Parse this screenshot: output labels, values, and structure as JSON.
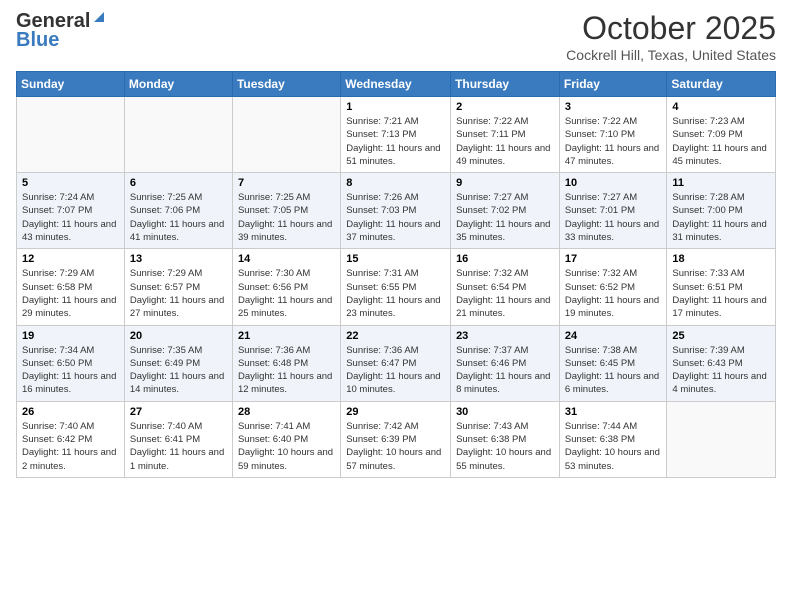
{
  "header": {
    "logo_general": "General",
    "logo_blue": "Blue",
    "month_title": "October 2025",
    "subtitle": "Cockrell Hill, Texas, United States"
  },
  "days_of_week": [
    "Sunday",
    "Monday",
    "Tuesday",
    "Wednesday",
    "Thursday",
    "Friday",
    "Saturday"
  ],
  "weeks": [
    [
      {
        "day": "",
        "info": ""
      },
      {
        "day": "",
        "info": ""
      },
      {
        "day": "",
        "info": ""
      },
      {
        "day": "1",
        "info": "Sunrise: 7:21 AM\nSunset: 7:13 PM\nDaylight: 11 hours and 51 minutes."
      },
      {
        "day": "2",
        "info": "Sunrise: 7:22 AM\nSunset: 7:11 PM\nDaylight: 11 hours and 49 minutes."
      },
      {
        "day": "3",
        "info": "Sunrise: 7:22 AM\nSunset: 7:10 PM\nDaylight: 11 hours and 47 minutes."
      },
      {
        "day": "4",
        "info": "Sunrise: 7:23 AM\nSunset: 7:09 PM\nDaylight: 11 hours and 45 minutes."
      }
    ],
    [
      {
        "day": "5",
        "info": "Sunrise: 7:24 AM\nSunset: 7:07 PM\nDaylight: 11 hours and 43 minutes."
      },
      {
        "day": "6",
        "info": "Sunrise: 7:25 AM\nSunset: 7:06 PM\nDaylight: 11 hours and 41 minutes."
      },
      {
        "day": "7",
        "info": "Sunrise: 7:25 AM\nSunset: 7:05 PM\nDaylight: 11 hours and 39 minutes."
      },
      {
        "day": "8",
        "info": "Sunrise: 7:26 AM\nSunset: 7:03 PM\nDaylight: 11 hours and 37 minutes."
      },
      {
        "day": "9",
        "info": "Sunrise: 7:27 AM\nSunset: 7:02 PM\nDaylight: 11 hours and 35 minutes."
      },
      {
        "day": "10",
        "info": "Sunrise: 7:27 AM\nSunset: 7:01 PM\nDaylight: 11 hours and 33 minutes."
      },
      {
        "day": "11",
        "info": "Sunrise: 7:28 AM\nSunset: 7:00 PM\nDaylight: 11 hours and 31 minutes."
      }
    ],
    [
      {
        "day": "12",
        "info": "Sunrise: 7:29 AM\nSunset: 6:58 PM\nDaylight: 11 hours and 29 minutes."
      },
      {
        "day": "13",
        "info": "Sunrise: 7:29 AM\nSunset: 6:57 PM\nDaylight: 11 hours and 27 minutes."
      },
      {
        "day": "14",
        "info": "Sunrise: 7:30 AM\nSunset: 6:56 PM\nDaylight: 11 hours and 25 minutes."
      },
      {
        "day": "15",
        "info": "Sunrise: 7:31 AM\nSunset: 6:55 PM\nDaylight: 11 hours and 23 minutes."
      },
      {
        "day": "16",
        "info": "Sunrise: 7:32 AM\nSunset: 6:54 PM\nDaylight: 11 hours and 21 minutes."
      },
      {
        "day": "17",
        "info": "Sunrise: 7:32 AM\nSunset: 6:52 PM\nDaylight: 11 hours and 19 minutes."
      },
      {
        "day": "18",
        "info": "Sunrise: 7:33 AM\nSunset: 6:51 PM\nDaylight: 11 hours and 17 minutes."
      }
    ],
    [
      {
        "day": "19",
        "info": "Sunrise: 7:34 AM\nSunset: 6:50 PM\nDaylight: 11 hours and 16 minutes."
      },
      {
        "day": "20",
        "info": "Sunrise: 7:35 AM\nSunset: 6:49 PM\nDaylight: 11 hours and 14 minutes."
      },
      {
        "day": "21",
        "info": "Sunrise: 7:36 AM\nSunset: 6:48 PM\nDaylight: 11 hours and 12 minutes."
      },
      {
        "day": "22",
        "info": "Sunrise: 7:36 AM\nSunset: 6:47 PM\nDaylight: 11 hours and 10 minutes."
      },
      {
        "day": "23",
        "info": "Sunrise: 7:37 AM\nSunset: 6:46 PM\nDaylight: 11 hours and 8 minutes."
      },
      {
        "day": "24",
        "info": "Sunrise: 7:38 AM\nSunset: 6:45 PM\nDaylight: 11 hours and 6 minutes."
      },
      {
        "day": "25",
        "info": "Sunrise: 7:39 AM\nSunset: 6:43 PM\nDaylight: 11 hours and 4 minutes."
      }
    ],
    [
      {
        "day": "26",
        "info": "Sunrise: 7:40 AM\nSunset: 6:42 PM\nDaylight: 11 hours and 2 minutes."
      },
      {
        "day": "27",
        "info": "Sunrise: 7:40 AM\nSunset: 6:41 PM\nDaylight: 11 hours and 1 minute."
      },
      {
        "day": "28",
        "info": "Sunrise: 7:41 AM\nSunset: 6:40 PM\nDaylight: 10 hours and 59 minutes."
      },
      {
        "day": "29",
        "info": "Sunrise: 7:42 AM\nSunset: 6:39 PM\nDaylight: 10 hours and 57 minutes."
      },
      {
        "day": "30",
        "info": "Sunrise: 7:43 AM\nSunset: 6:38 PM\nDaylight: 10 hours and 55 minutes."
      },
      {
        "day": "31",
        "info": "Sunrise: 7:44 AM\nSunset: 6:38 PM\nDaylight: 10 hours and 53 minutes."
      },
      {
        "day": "",
        "info": ""
      }
    ]
  ]
}
